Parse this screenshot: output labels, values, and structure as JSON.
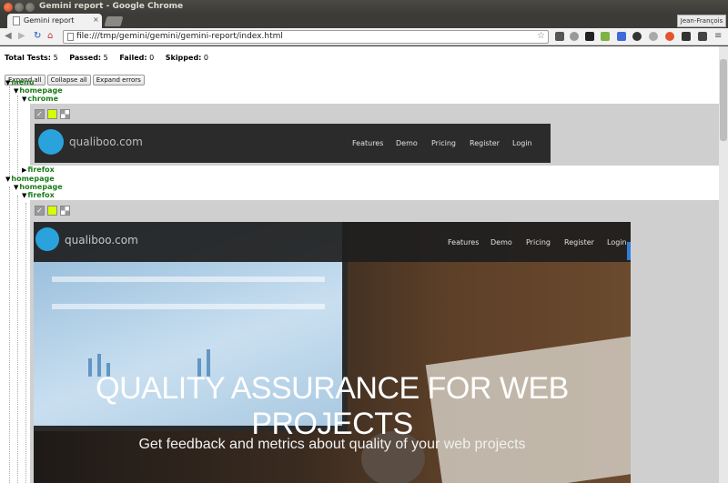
{
  "window": {
    "title": "Gemini report - Google Chrome"
  },
  "tab": {
    "title": "Gemini report",
    "close": "×"
  },
  "profile": {
    "name": "Jean-François"
  },
  "toolbar": {
    "back": "◀",
    "forward": "▶",
    "reload": "↻",
    "home": "⌂",
    "url": "file:///tmp/gemini/gemini/gemini-report/index.html",
    "star": "☆",
    "menu": "≡"
  },
  "summary": {
    "total_label": "Total Tests:",
    "total": "5",
    "passed_label": "Passed:",
    "passed": "5",
    "failed_label": "Failed:",
    "failed": "0",
    "skipped_label": "Skipped:",
    "skipped": "0"
  },
  "buttons": {
    "expand_all": "Expand all",
    "collapse_all": "Collapse all",
    "expand_errors": "Expand errors"
  },
  "tree": {
    "suite1": "menu",
    "suite1_state": "homepage",
    "suite1_browser1": "chrome",
    "suite1_browser2": "firefox",
    "suite2": "homepage",
    "suite2_state": "homepage",
    "suite2_browser1": "firefox",
    "expanded_arrow": "▼",
    "collapsed_arrow": "▶"
  },
  "screenshot_small": {
    "brand": "qualiboo.com",
    "links": [
      "Features",
      "Demo",
      "Pricing",
      "Register",
      "Login"
    ]
  },
  "screenshot_large": {
    "brand": "qualiboo.com",
    "links": [
      "Features",
      "Demo",
      "Pricing",
      "Register",
      "Login"
    ],
    "headline": "QUALITY ASSURANCE FOR WEB PROJECTS",
    "subheadline": "Get feedback and metrics about quality of your web projects"
  },
  "colors": {
    "tree_green": "#1a7c1a",
    "brand_blue": "#2aa3dd",
    "diff_lime": "#d5ff00"
  }
}
